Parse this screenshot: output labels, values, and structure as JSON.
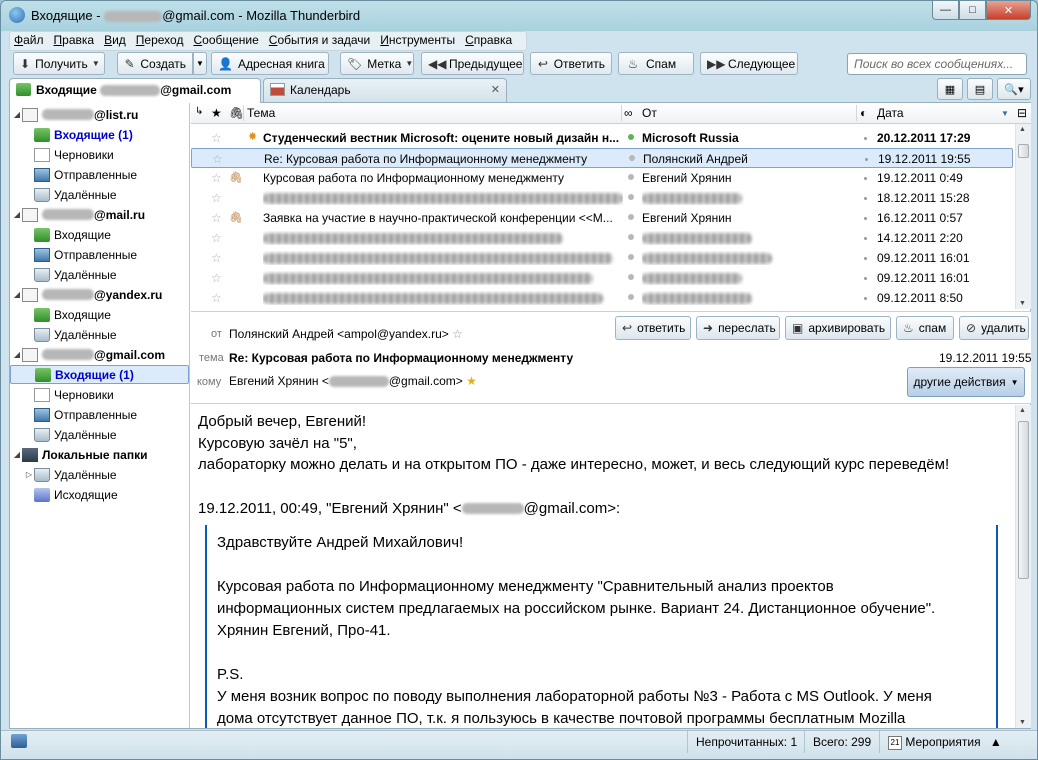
{
  "window": {
    "title_prefix": "Входящие - ",
    "title_suffix": "@gmail.com - Mozilla Thunderbird",
    "controls": {
      "minimize": "—",
      "maximize": "□",
      "close": "✕"
    }
  },
  "menu": [
    "Файл",
    "Правка",
    "Вид",
    "Переход",
    "Сообщение",
    "События и задачи",
    "Инструменты",
    "Справка"
  ],
  "toolbar": {
    "get": "Получить",
    "compose": "Создать",
    "addressbook": "Адресная книга",
    "tag": "Метка",
    "previous": "Предыдущее",
    "reply": "Ответить",
    "spam": "Спам",
    "next": "Следующее",
    "search_placeholder": "Поиск во всех сообщениях..."
  },
  "tabs": {
    "mail_prefix": "Входящие",
    "mail_suffix": "@gmail.com",
    "calendar": "Календарь",
    "close": "✕"
  },
  "folders": [
    {
      "label": "@list.ru",
      "type": "account",
      "blurred": true
    },
    {
      "label": "Входящие (1)",
      "type": "inbox",
      "unread": true
    },
    {
      "label": "Черновики",
      "type": "draft"
    },
    {
      "label": "Отправленные",
      "type": "sent"
    },
    {
      "label": "Удалённые",
      "type": "trash"
    },
    {
      "label": "@mail.ru",
      "type": "account",
      "blurred": true
    },
    {
      "label": "Входящие",
      "type": "inbox"
    },
    {
      "label": "Отправленные",
      "type": "sent"
    },
    {
      "label": "Удалённые",
      "type": "trash"
    },
    {
      "label": "@yandex.ru",
      "type": "account",
      "blurred": true
    },
    {
      "label": "Входящие",
      "type": "inbox"
    },
    {
      "label": "Удалённые",
      "type": "trash"
    },
    {
      "label": "@gmail.com",
      "type": "account",
      "blurred": true
    },
    {
      "label": "Входящие (1)",
      "type": "inbox",
      "unread": true,
      "selected": true
    },
    {
      "label": "Черновики",
      "type": "draft"
    },
    {
      "label": "Отправленные",
      "type": "sent"
    },
    {
      "label": "Удалённые",
      "type": "trash"
    },
    {
      "label": "Локальные папки",
      "type": "local"
    },
    {
      "label": "Удалённые",
      "type": "trash"
    },
    {
      "label": "Исходящие",
      "type": "outbox"
    }
  ],
  "thread_columns": {
    "subject": "Тема",
    "from": "От",
    "date": "Дата"
  },
  "messages": [
    {
      "subject": "Студенческий вестник Microsoft: оцените новый дизайн н...",
      "from": "Microsoft Russia",
      "date": "20.12.2011 17:29",
      "bold": true,
      "att": false,
      "green": true
    },
    {
      "subject": "Re: Курсовая работа по Информационному менеджменту",
      "from": "Полянский Андрей",
      "date": "19.12.2011 19:55",
      "selected": true
    },
    {
      "subject": "Курсовая работа по Информационному менеджменту",
      "from": "Евгений Хрянин",
      "date": "19.12.2011 0:49",
      "att": true
    },
    {
      "subject": "",
      "from": "",
      "date": "18.12.2011 15:28",
      "blur_subject": true,
      "blur_from": true
    },
    {
      "subject": "Заявка на участие в научно-практической конференции <<М...",
      "from": "Евгений Хрянин",
      "date": "16.12.2011 0:57",
      "att": true
    },
    {
      "subject": "",
      "from": "",
      "date": "14.12.2011 2:20",
      "blur_subject": true,
      "blur_from": true
    },
    {
      "subject": "",
      "from": "",
      "date": "09.12.2011 16:01",
      "blur_subject": true,
      "blur_from": true
    },
    {
      "subject": "",
      "from": "",
      "date": "09.12.2011 16:01",
      "blur_subject": true,
      "blur_from": true
    },
    {
      "subject": "",
      "from": "",
      "date": "09.12.2011 8:50",
      "blur_subject": true,
      "blur_from": true
    }
  ],
  "header": {
    "from_label": "от",
    "from_value": "Полянский Андрей <ampol@yandex.ru>",
    "subject_label": "тема",
    "subject_value": "Re: Курсовая работа по Информационному менеджменту",
    "to_label": "кому",
    "to_prefix": "Евгений Хрянин <",
    "to_suffix": "@gmail.com>",
    "date": "19.12.2011 19:55",
    "actions": [
      "ответить",
      "переслать",
      "архивировать",
      "спам",
      "удалить"
    ],
    "other_actions": "другие действия"
  },
  "body": {
    "lines": [
      "Добрый вечер, Евгений!",
      "Курсовую зачёл на \"5\",",
      "лабораторку можно делать и на открытом ПО - даже интересно, может, и весь следующий курс переведём!"
    ],
    "attribution_prefix": "19.12.2011, 00:49, \"Евгений Хрянин\" <",
    "attribution_suffix": "@gmail.com>:",
    "quote_lines": [
      "Здравствуйте Андрей Михайлович!",
      "",
      "Курсовая работа по Информационному менеджменту \"Сравнительный анализ проектов",
      "информационных систем предлагаемых на российском рынке. Вариант 24. Дистанционное обучение\".",
      "Хрянин Евгений, Про-41.",
      "",
      "P.S.",
      "У меня возник вопрос по поводу выполнения лабораторной работы №3 - Работа с MS Outlook. У меня",
      "дома отсутствует данное ПО, т.к. я пользуюсь в качестве почтовой программы бесплатным Mozilla"
    ]
  },
  "status": {
    "unread": "Непрочитанных: 1",
    "total": "Всего: 299",
    "events": "Мероприятия",
    "cal_day": "21"
  }
}
